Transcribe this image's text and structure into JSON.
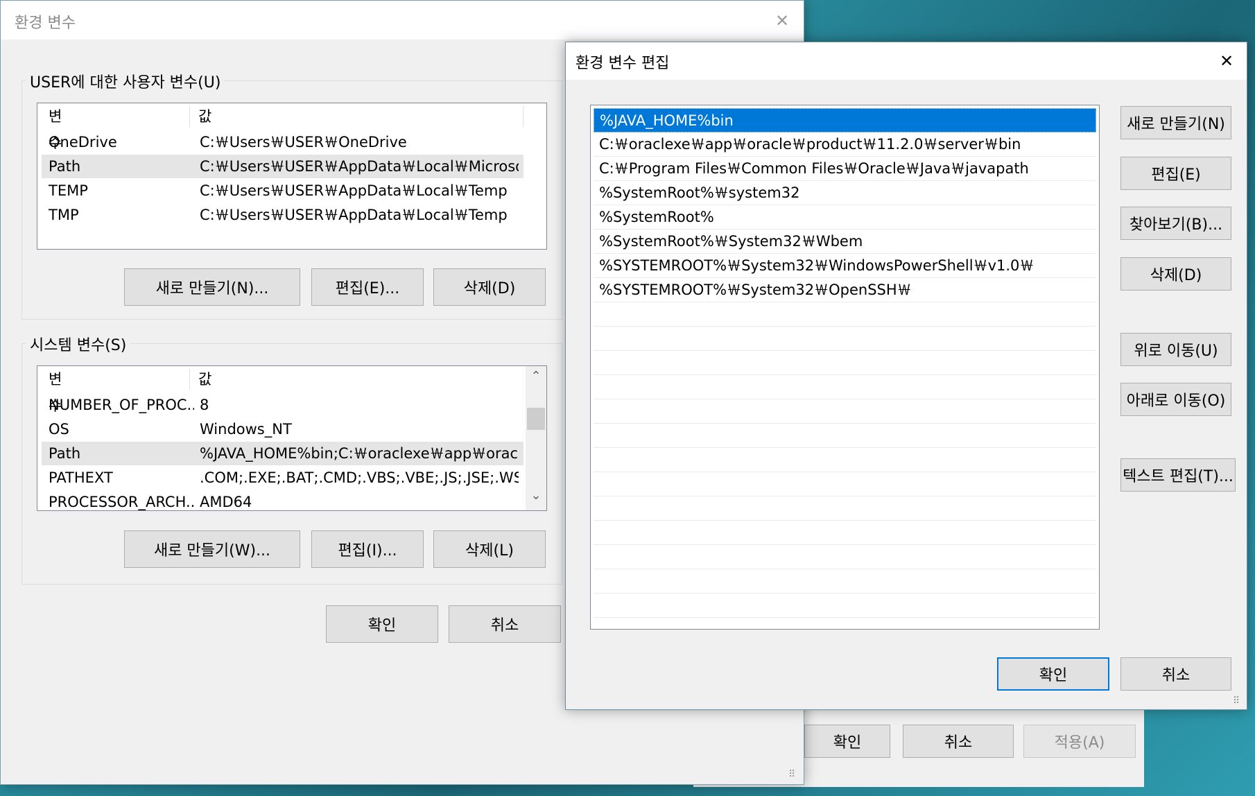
{
  "env_dialog": {
    "title": "환경 변수",
    "user_group_label": "USER에 대한 사용자 변수(U)",
    "system_group_label": "시스템 변수(S)",
    "col_variable": "변수",
    "col_value": "값",
    "user_vars": [
      {
        "name": "OneDrive",
        "value": "C:￦Users￦USER￦OneDrive"
      },
      {
        "name": "Path",
        "value": "C:￦Users￦USER￦AppData￦Local￦Microsoft..."
      },
      {
        "name": "TEMP",
        "value": "C:￦Users￦USER￦AppData￦Local￦Temp"
      },
      {
        "name": "TMP",
        "value": "C:￦Users￦USER￦AppData￦Local￦Temp"
      }
    ],
    "system_vars": [
      {
        "name": "NUMBER_OF_PROC...",
        "value": "8"
      },
      {
        "name": "OS",
        "value": "Windows_NT"
      },
      {
        "name": "Path",
        "value": "%JAVA_HOME%bin;C:￦oraclexe￦app￦oracle..."
      },
      {
        "name": "PATHEXT",
        "value": ".COM;.EXE;.BAT;.CMD;.VBS;.VBE;.JS;.JSE;.WSF;...."
      },
      {
        "name": "PROCESSOR_ARCH...",
        "value": "AMD64"
      }
    ],
    "user_buttons": {
      "new": "새로 만들기(N)...",
      "edit": "편집(E)...",
      "delete": "삭제(D)"
    },
    "system_buttons": {
      "new": "새로 만들기(W)...",
      "edit": "편집(I)...",
      "delete": "삭제(L)"
    },
    "ok": "확인",
    "cancel": "취소"
  },
  "back_dialog": {
    "ok": "확인",
    "cancel": "취소",
    "apply": "적용(A)"
  },
  "edit_dialog": {
    "title": "환경 변수 편집",
    "entries": [
      "%JAVA_HOME%bin",
      "C:￦oraclexe￦app￦oracle￦product￦11.2.0￦server￦bin",
      "C:￦Program Files￦Common Files￦Oracle￦Java￦javapath",
      "%SystemRoot%￦system32",
      "%SystemRoot%",
      "%SystemRoot%￦System32￦Wbem",
      "%SYSTEMROOT%￦System32￦WindowsPowerShell￦v1.0￦",
      "%SYSTEMROOT%￦System32￦OpenSSH￦"
    ],
    "selected_index": 0,
    "buttons": {
      "new": "새로 만들기(N)",
      "edit": "편집(E)",
      "browse": "찾아보기(B)...",
      "delete": "삭제(D)",
      "move_up": "위로 이동(U)",
      "move_down": "아래로 이동(O)",
      "edit_text": "텍스트 편집(T)..."
    },
    "ok": "확인",
    "cancel": "취소"
  },
  "icons": {
    "close": "✕",
    "scroll_up": "⌃",
    "scroll_down": "⌄",
    "grip": "⠿"
  }
}
